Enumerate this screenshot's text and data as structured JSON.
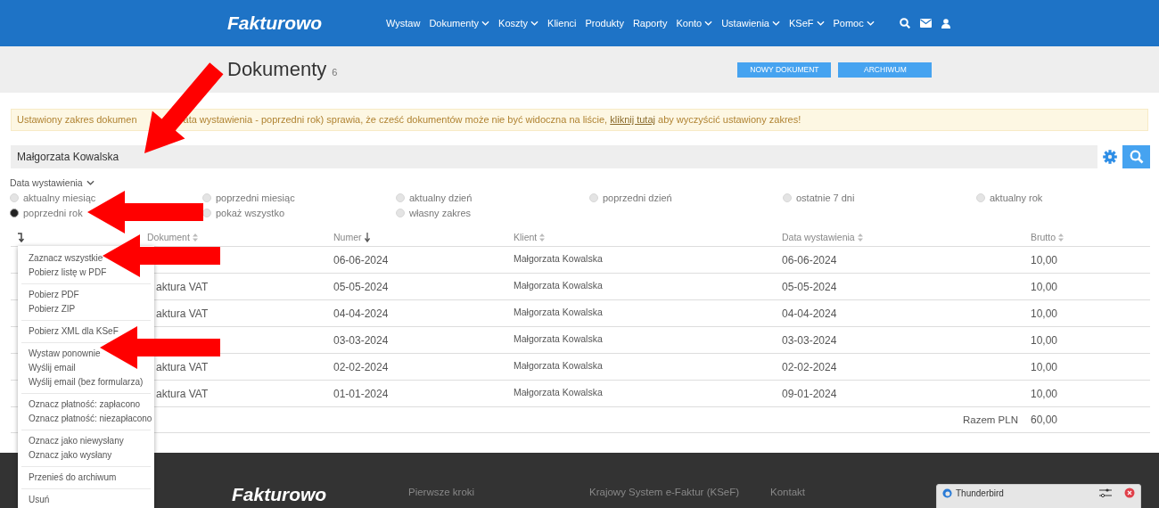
{
  "header": {
    "logo": "Fakturowo",
    "nav": [
      {
        "label": "Wystaw",
        "dropdown": false
      },
      {
        "label": "Dokumenty",
        "dropdown": true
      },
      {
        "label": "Koszty",
        "dropdown": true
      },
      {
        "label": "Klienci",
        "dropdown": false
      },
      {
        "label": "Produkty",
        "dropdown": false
      },
      {
        "label": "Raporty",
        "dropdown": false
      },
      {
        "label": "Konto",
        "dropdown": true
      },
      {
        "label": "Ustawienia",
        "dropdown": true
      },
      {
        "label": "KSeF",
        "dropdown": true
      },
      {
        "label": "Pomoc",
        "dropdown": true
      }
    ]
  },
  "title_bar": {
    "title": "Dokumenty",
    "count": "6",
    "buttons": [
      "NOWY DOKUMENT",
      "ARCHIWUM"
    ]
  },
  "alert": {
    "text_start": "Ustawiony zakres dokumen",
    "text_before": "ata wystawienia - poprzedni rok) sprawia, że cześć dokumentów może nie być widoczna na liście,",
    "link": "kliknij tutaj",
    "text_after": "aby wyczyścić ustawiony zakres!"
  },
  "search_bar": {
    "value": "Małgorzata Kowalska"
  },
  "filter": {
    "label": "Data wystawienia",
    "options": [
      {
        "label": "aktualny miesiąc",
        "selected": false
      },
      {
        "label": "poprzedni miesiąc",
        "selected": false
      },
      {
        "label": "aktualny dzień",
        "selected": false
      },
      {
        "label": "poprzedni dzień",
        "selected": false
      },
      {
        "label": "ostatnie 7 dni",
        "selected": false
      },
      {
        "label": "aktualny rok",
        "selected": false
      },
      {
        "label": "poprzedni rok",
        "selected": true
      },
      {
        "label": "pokaż wszystko",
        "selected": false
      },
      {
        "label": "własny zakres",
        "selected": false
      }
    ]
  },
  "table": {
    "columns": [
      {
        "label": "Dokument",
        "kind": "sortable"
      },
      {
        "label": "Numer",
        "kind": "sorted-desc"
      },
      {
        "label": "Klient",
        "kind": "sortable"
      },
      {
        "label": "Data wystawienia",
        "kind": "sortable"
      },
      {
        "label": "Brutto",
        "kind": "sortable"
      }
    ],
    "rows": [
      {
        "document": "",
        "number": "06-06-2024",
        "client": "Małgorzata Kowalska",
        "date": "06-06-2024",
        "gross": "10,00"
      },
      {
        "document": "aktura VAT",
        "number": "05-05-2024",
        "client": "Małgorzata Kowalska",
        "date": "05-05-2024",
        "gross": "10,00"
      },
      {
        "document": "aktura VAT",
        "number": "04-04-2024",
        "client": "Małgorzata Kowalska",
        "date": "04-04-2024",
        "gross": "10,00"
      },
      {
        "document": "",
        "number": "03-03-2024",
        "client": "Małgorzata Kowalska",
        "date": "03-03-2024",
        "gross": "10,00"
      },
      {
        "document": "aktura VAT",
        "number": "02-02-2024",
        "client": "Małgorzata Kowalska",
        "date": "02-02-2024",
        "gross": "10,00"
      },
      {
        "document": "aktura VAT",
        "number": "01-01-2024",
        "client": "Małgorzata Kowalska",
        "date": "09-01-2024",
        "gross": "10,00"
      }
    ],
    "total_label": "Razem PLN",
    "total": "60,00"
  },
  "menu": {
    "groups": [
      {
        "items": [
          "Zaznacz wszystkie",
          "Pobierz listę w PDF"
        ]
      },
      {
        "items": [
          "Pobierz PDF",
          "Pobierz ZIP"
        ]
      },
      {
        "items": [
          "Pobierz XML dla KSeF"
        ]
      },
      {
        "items": [
          "Wystaw ponownie",
          "Wyślij email",
          "Wyślij email (bez formularza)"
        ]
      },
      {
        "items": [
          "Oznacz płatność: zapłacono",
          "Oznacz płatność: niezapłacono"
        ]
      },
      {
        "items": [
          "Oznacz jako niewysłany",
          "Oznacz jako wysłany"
        ]
      },
      {
        "items": [
          "Przenieś do archiwum"
        ]
      },
      {
        "items": [
          "Usuń"
        ]
      }
    ]
  },
  "footer": {
    "logo": "Fakturowo",
    "links": [
      "Pierwsze kroki",
      "Krajowy System e-Faktur (KSeF)",
      "Kontakt"
    ]
  },
  "notification": {
    "app": "Thunderbird"
  }
}
